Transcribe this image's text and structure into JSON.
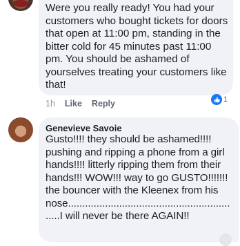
{
  "top_comment": {
    "author": "",
    "text": "Were you really ready! You had your customers who bought tickets for doors that open at 11:00 pm, standing in the bitter cold for 45 minutes past 11:00 pm. You should be ashamed of yourselves treating your customers like that!",
    "time": "1h",
    "like_label": "Like",
    "reply_label": "Reply",
    "reaction_count": "1",
    "reaction_icon": "thumbs-up-icon",
    "reaction_color": "#1877f2"
  },
  "second_comment": {
    "author": "Genevieve Savoie",
    "text": "Gusto!!!! they should be ashamed!!!! pushing and ripping a phone from a girl hands!!!! litterly ripping them from their hands!!! WOW!!! way to go GUSTO!!!!!!! the bouncer with the Kleenex from his nose.........................................................\n.....I will never be there AGAIN!!"
  },
  "colors": {
    "bubble": "#f0f2f5",
    "text": "#1c1e21",
    "meta": "#606770"
  }
}
